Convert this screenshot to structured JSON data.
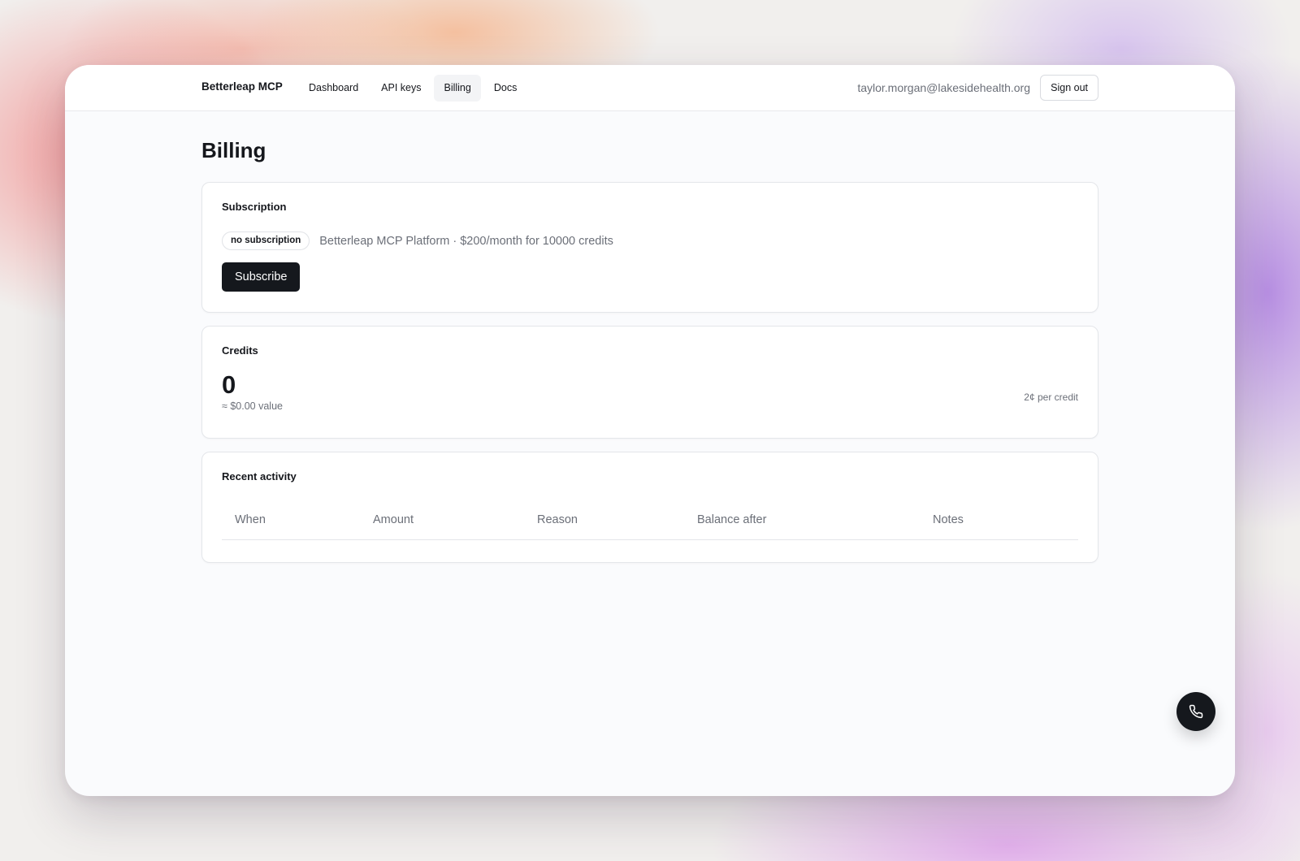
{
  "header": {
    "brand": "Betterleap MCP",
    "nav": [
      {
        "label": "Dashboard"
      },
      {
        "label": "API keys"
      },
      {
        "label": "Billing",
        "active": true
      },
      {
        "label": "Docs"
      }
    ],
    "user_email": "taylor.morgan@lakesidehealth.org",
    "sign_out_label": "Sign out"
  },
  "page": {
    "title": "Billing"
  },
  "subscription": {
    "title": "Subscription",
    "status_badge": "no subscription",
    "plan_description": "Betterleap MCP Platform · $200/month for 10000 credits",
    "subscribe_label": "Subscribe"
  },
  "credits": {
    "title": "Credits",
    "balance": "0",
    "value_text": "≈ $0.00 value",
    "rate_text": "2¢ per credit"
  },
  "activity": {
    "title": "Recent activity",
    "columns": [
      "When",
      "Amount",
      "Reason",
      "Balance after",
      "Notes"
    ]
  },
  "icons": {
    "fab": "phone-icon"
  },
  "colors": {
    "primary_button": "#15181d",
    "muted_text": "#6b6f78",
    "border": "#e4e6ea"
  }
}
